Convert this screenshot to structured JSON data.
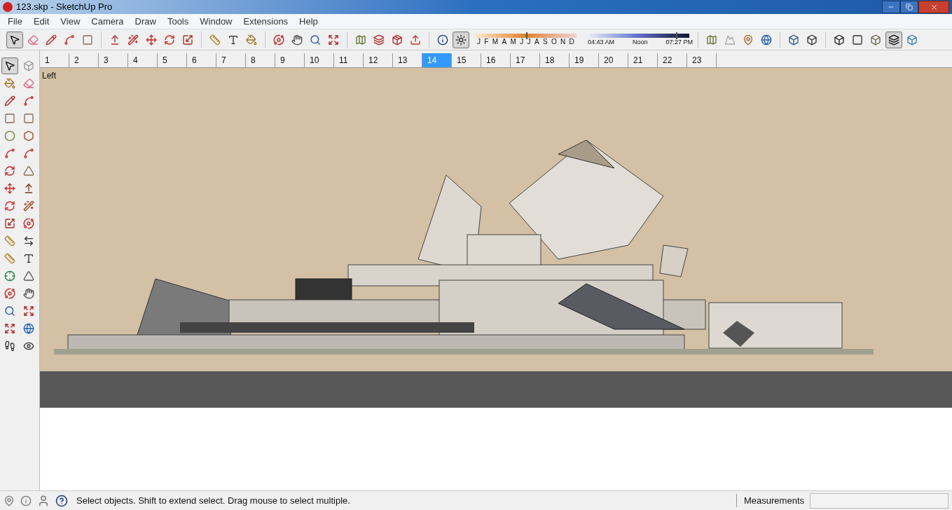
{
  "window": {
    "title": "123.skp - SketchUp Pro"
  },
  "menu": [
    "File",
    "Edit",
    "View",
    "Camera",
    "Draw",
    "Tools",
    "Window",
    "Extensions",
    "Help"
  ],
  "toolbar": {
    "tools": [
      {
        "selected": true
      },
      {
        "selected": false
      },
      {
        "selected": false
      },
      {
        "selected": false
      },
      {
        "selected": false
      },
      {
        "selected": false
      },
      {
        "selected": false
      },
      {
        "selected": false
      },
      {
        "selected": false
      },
      {
        "selected": false
      },
      {
        "selected": false
      },
      {
        "selected": false
      },
      {
        "selected": false
      },
      {
        "selected": false
      },
      {
        "selected": false
      },
      {
        "selected": false
      },
      {
        "selected": false
      },
      {
        "selected": false
      },
      {
        "selected": false
      },
      {
        "selected": false
      },
      {
        "selected": false
      },
      {
        "selected": false
      },
      {
        "selected": true
      }
    ],
    "months": [
      "J",
      "F",
      "M",
      "A",
      "M",
      "J",
      "J",
      "A",
      "S",
      "O",
      "N",
      "D"
    ],
    "month_slider": {
      "level": 0.5
    },
    "times": [
      "04:43 AM",
      "Noon",
      "07:27 PM"
    ],
    "time_slider": {
      "level": 0.87
    },
    "view_tools": [
      {
        "selected": false
      },
      {
        "selected": false
      },
      {
        "selected": false
      },
      {
        "selected": false
      },
      {
        "selected": false
      },
      {
        "selected": false
      },
      {
        "selected": false
      },
      {
        "selected": false
      },
      {
        "selected": false
      },
      {
        "selected": true
      },
      {
        "selected": false
      }
    ]
  },
  "scenes": [
    {
      "label": "1",
      "selected": false
    },
    {
      "label": "2",
      "selected": false
    },
    {
      "label": "3",
      "selected": false
    },
    {
      "label": "4",
      "selected": false
    },
    {
      "label": "5",
      "selected": false
    },
    {
      "label": "6",
      "selected": false
    },
    {
      "label": "7",
      "selected": false
    },
    {
      "label": "8",
      "selected": false
    },
    {
      "label": "9",
      "selected": false
    },
    {
      "label": "10",
      "selected": false
    },
    {
      "label": "11",
      "selected": false
    },
    {
      "label": "12",
      "selected": false
    },
    {
      "label": "13",
      "selected": false
    },
    {
      "label": "14",
      "selected": true
    },
    {
      "label": "15",
      "selected": false
    },
    {
      "label": "16",
      "selected": false
    },
    {
      "label": "17",
      "selected": false
    },
    {
      "label": "18",
      "selected": false
    },
    {
      "label": "19",
      "selected": false
    },
    {
      "label": "20",
      "selected": false
    },
    {
      "label": "21",
      "selected": false
    },
    {
      "label": "22",
      "selected": false
    },
    {
      "label": "23",
      "selected": false
    }
  ],
  "palette": [
    true,
    false,
    false,
    false,
    false,
    false,
    false,
    false,
    false,
    false,
    false,
    false,
    false,
    false,
    false,
    false,
    false,
    false,
    false,
    false,
    false,
    false,
    false,
    false,
    false,
    false,
    false,
    false,
    false,
    false,
    false,
    false,
    false,
    false
  ],
  "viewport": {
    "view_label": "Left"
  },
  "status_bar": {
    "message": "Select objects. Shift to extend select. Drag mouse to select multiple.",
    "measurements_label": "Measurements"
  }
}
